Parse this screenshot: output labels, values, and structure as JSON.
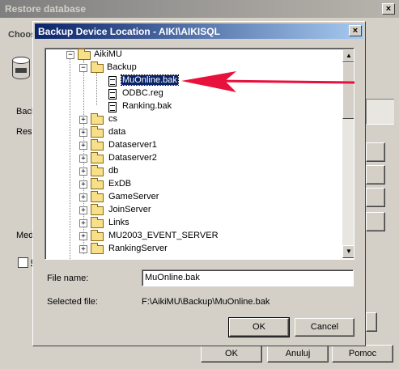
{
  "back_window": {
    "title": "Restore database",
    "close_glyph": "×",
    "tab_label_partial": "Choos",
    "label_backup": "Back",
    "label_restore": "Resto",
    "label_media": "Medi",
    "checkbox_partial": "O",
    "ok_label": "OK",
    "cancel_label": "Anuluj",
    "help_label": "Pomoc"
  },
  "dialog": {
    "title": "Backup Device Location - AIKI\\AIKISQL",
    "close_glyph": "×",
    "tree": {
      "root": "AikiMU",
      "backup_folder": "Backup",
      "files": [
        "MuOnline.bak",
        "ODBC.reg",
        "Ranking.bak"
      ],
      "selected_file": "MuOnline.bak",
      "folders": [
        "cs",
        "data",
        "Dataserver1",
        "Dataserver2",
        "db",
        "ExDB",
        "GameServer",
        "JoinServer",
        "Links",
        "MU2003_EVENT_SERVER",
        "RankingServer"
      ]
    },
    "file_name_label": "File name:",
    "file_name_value": "MuOnline.bak",
    "selected_file_label": "Selected file:",
    "selected_file_value": "F:\\AikiMU\\Backup\\MuOnline.bak",
    "ok_label": "OK",
    "cancel_label": "Cancel"
  },
  "icons": {
    "folder": "folder-icon",
    "file": "file-icon",
    "expander_plus": "+",
    "expander_minus": "−",
    "scroll_up": "▲",
    "scroll_down": "▼",
    "annotation": "red-arrow"
  },
  "colors": {
    "dialog_titlebar": "#0a246a",
    "selection": "#0a246a",
    "annotation_arrow": "#e8103c"
  }
}
